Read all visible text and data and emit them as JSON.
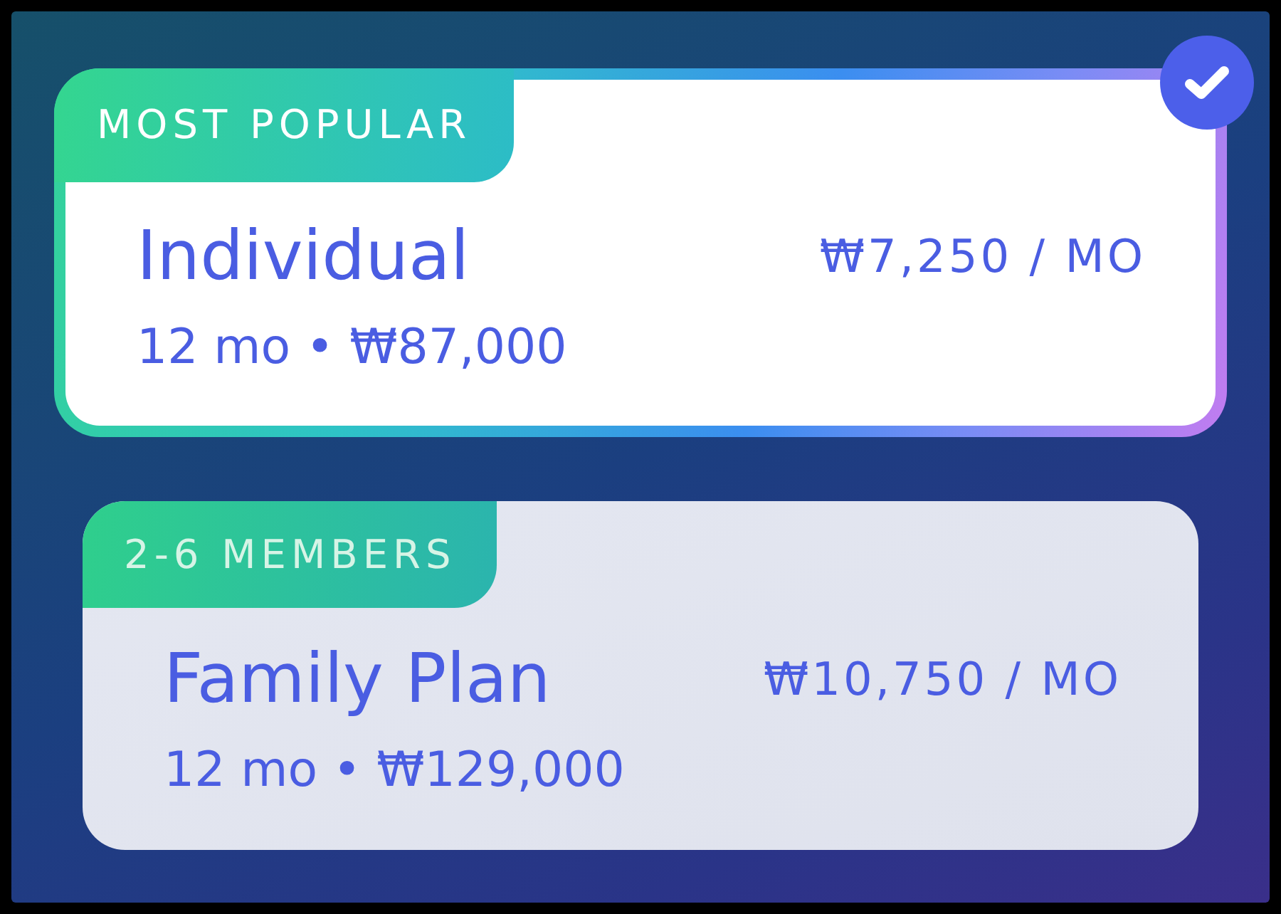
{
  "plans": [
    {
      "badge": "MOST POPULAR",
      "name": "Individual",
      "billing": "12 mo • ₩87,000",
      "price": "₩7,250 / MO",
      "selected": true
    },
    {
      "badge": "2-6 MEMBERS",
      "name": "Family Plan",
      "billing": "12 mo • ₩129,000",
      "price": "₩10,750 / MO",
      "selected": false
    }
  ]
}
